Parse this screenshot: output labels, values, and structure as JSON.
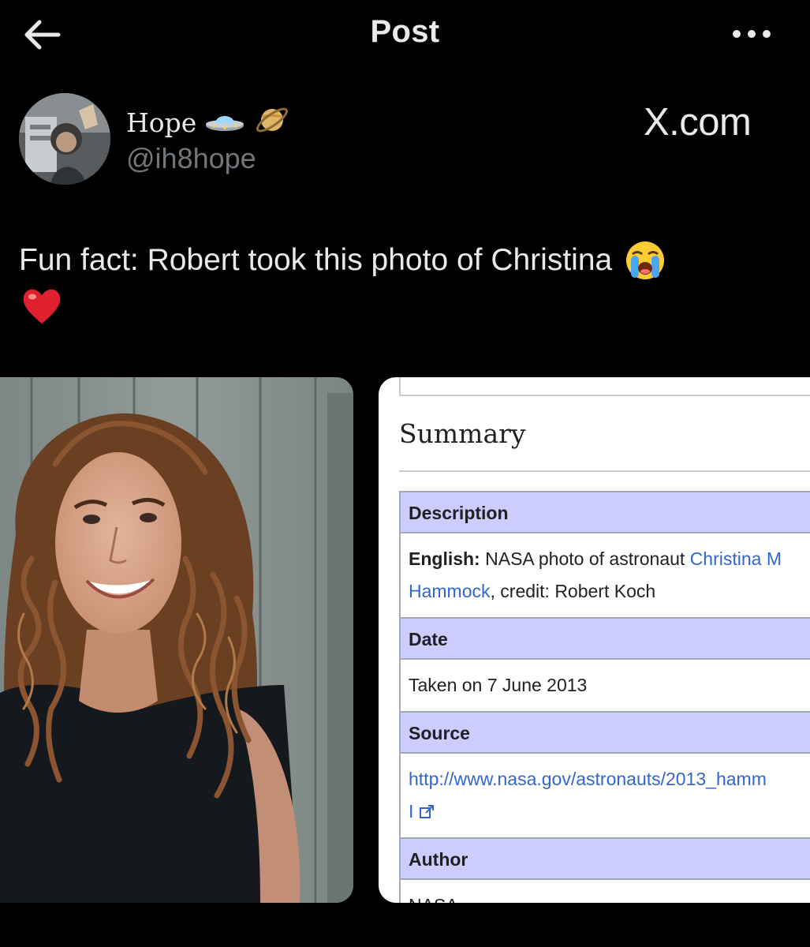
{
  "header": {
    "title": "Post",
    "back_icon": "arrow-left-icon",
    "more_icon": "more-horizontal-icon"
  },
  "author": {
    "name": "Hope",
    "handle": "@ih8hope",
    "name_emojis": [
      "flying-saucer-icon",
      "ringed-planet-icon"
    ]
  },
  "brand": {
    "label": "X.com"
  },
  "post": {
    "text": "Fun fact: Robert took this photo of Christina",
    "emojis": [
      "loudly-crying-face-icon",
      "red-heart-icon"
    ]
  },
  "card": {
    "summary_title": "Summary",
    "description_header": "Description",
    "english_label": "English:",
    "description_text": "NASA photo of astronaut",
    "description_link_1": "Christina M",
    "description_link_2": "Hammock",
    "credit_text": ", credit: Robert Koch",
    "date_header": "Date",
    "date_value": "Taken on 7 June 2013",
    "source_header": "Source",
    "source_link": "http://www.nasa.gov/astronauts/2013_hamm",
    "source_link_2": "I",
    "author_header": "Author",
    "author_value": "NASA"
  },
  "colors": {
    "background": "#000000",
    "text": "#e7e9ea",
    "muted": "#71767b",
    "wiki_header": "#ccccff",
    "wiki_link": "#3366cc"
  }
}
